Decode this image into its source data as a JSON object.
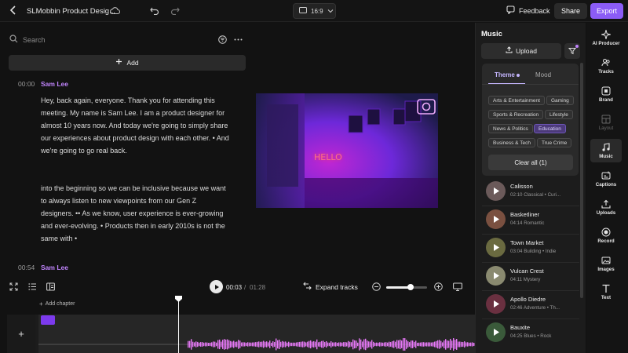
{
  "header": {
    "project_title": "SLMobbin Product Desig...",
    "aspect_ratio": "16:9",
    "feedback_label": "Feedback",
    "share_label": "Share",
    "export_label": "Export"
  },
  "transcript": {
    "search_placeholder": "Search",
    "add_label": "Add",
    "segments": [
      {
        "time": "00:00",
        "speaker": "Sam Lee",
        "paragraph1": "Hey, back again, everyone. Thank you for attending this meeting. My name is Sam Lee. I am a product designer for almost 10 years now. And today we're going to simply share our experiences about product design with each other. • And we're going to go real back.",
        "paragraph2": "into the beginning so we can be inclusive because we want to always listen to new viewpoints from our Gen Z designers. •• As we know, user experience is ever-growing and ever-evolving. • Products then in early 2010s is not the same with •"
      },
      {
        "time": "00:54",
        "speaker": "Sam Lee"
      }
    ]
  },
  "preview": {
    "neon_text": "HELLO"
  },
  "player": {
    "current_time": "00:03",
    "separator": "/",
    "total_time": "01:28",
    "expand_label": "Expand tracks",
    "zoom_level": 0.6
  },
  "timeline": {
    "add_chapter_label": "Add chapter",
    "add_track_symbol": "+"
  },
  "music_panel": {
    "title": "Music",
    "upload_label": "Upload",
    "tabs": [
      "Theme",
      "Mood"
    ],
    "chips": [
      {
        "label": "Arts & Entertainment",
        "selected": false
      },
      {
        "label": "Gaming",
        "selected": false
      },
      {
        "label": "Sports & Recreation",
        "selected": false
      },
      {
        "label": "Lifestyle",
        "selected": false
      },
      {
        "label": "News & Politics",
        "selected": false
      },
      {
        "label": "Education",
        "selected": true
      },
      {
        "label": "Business & Tech",
        "selected": false
      },
      {
        "label": "True Crime",
        "selected": false
      }
    ],
    "clear_label": "Clear all (1)",
    "tracks": [
      {
        "name": "Calisson",
        "meta": "02:10 Classical • Curi...",
        "color": "#6b5a5a"
      },
      {
        "name": "Basketliner",
        "meta": "04:14 Romantic",
        "color": "#7a5040"
      },
      {
        "name": "Town Market",
        "meta": "03:04 Building • Indie",
        "color": "#6a6a40"
      },
      {
        "name": "Vulcan Crest",
        "meta": "04:11 Mystery",
        "color": "#8a8a70"
      },
      {
        "name": "Apollo Diedre",
        "meta": "02:46 Adventure • Th...",
        "color": "#6a3040"
      },
      {
        "name": "Bauxite",
        "meta": "04:25 Blues • Rock",
        "color": "#3a5a3a"
      }
    ]
  },
  "rail": {
    "items": [
      {
        "label": "AI Producer",
        "icon": "sparkle-icon"
      },
      {
        "label": "Tracks",
        "icon": "people-icon"
      },
      {
        "label": "Brand",
        "icon": "brand-icon"
      },
      {
        "label": "Layout",
        "icon": "layout-icon",
        "disabled": true
      },
      {
        "label": "Music",
        "icon": "music-note-icon",
        "active": true
      },
      {
        "label": "Captions",
        "icon": "captions-icon"
      },
      {
        "label": "Uploads",
        "icon": "upload-icon"
      },
      {
        "label": "Record",
        "icon": "record-icon"
      },
      {
        "label": "Images",
        "icon": "image-icon"
      },
      {
        "label": "Text",
        "icon": "text-icon"
      }
    ]
  },
  "colors": {
    "accent": "#8b5cf6",
    "speaker": "#c084fc",
    "waveform": "#e879f9"
  }
}
